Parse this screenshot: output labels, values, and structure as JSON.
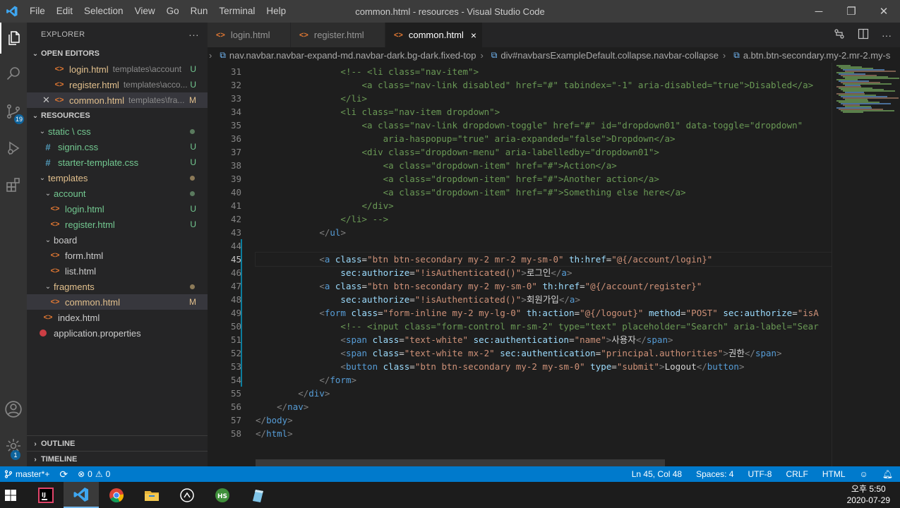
{
  "app": {
    "window_title": "common.html - resources - Visual Studio Code",
    "menu": [
      "File",
      "Edit",
      "Selection",
      "View",
      "Go",
      "Run",
      "Terminal",
      "Help"
    ]
  },
  "activity": {
    "scm_badge": "19",
    "settings_badge": "1"
  },
  "sidebar": {
    "title": "EXPLORER",
    "more": "···",
    "open_editors": {
      "label": "OPEN EDITORS",
      "items": [
        {
          "name": "login.html",
          "path": "templates\\account",
          "status": "U"
        },
        {
          "name": "register.html",
          "path": "templates\\acco...",
          "status": "U"
        },
        {
          "name": "common.html",
          "path": "templates\\fra...",
          "status": "M"
        }
      ]
    },
    "resources": {
      "label": "RESOURCES",
      "static_css": "static \\ css",
      "signin": "signin.css",
      "starter": "starter-template.css",
      "templates": "templates",
      "account": "account",
      "login": "login.html",
      "register": "register.html",
      "board": "board",
      "form": "form.html",
      "list": "list.html",
      "fragments": "fragments",
      "common": "common.html",
      "index": "index.html",
      "appprops": "application.properties",
      "status_u": "U",
      "status_m": "M"
    },
    "outline": "OUTLINE",
    "timeline": "TIMELINE"
  },
  "tabs": [
    {
      "label": "login.html"
    },
    {
      "label": "register.html"
    },
    {
      "label": "common.html",
      "close": "×"
    }
  ],
  "breadcrumb": {
    "lead": "›",
    "crumb1": "nav.navbar.navbar-expand-md.navbar-dark.bg-dark.fixed-top",
    "crumb2": "div#navbarsExampleDefault.collapse.navbar-collapse",
    "crumb3": "a.btn.btn-secondary.my-2.mr-2.my-s"
  },
  "editor": {
    "line_numbers": [
      "31",
      "32",
      "33",
      "34",
      "35",
      "36",
      "37",
      "38",
      "39",
      "40",
      "41",
      "42",
      "43",
      "44",
      "45",
      "46",
      "47",
      "48",
      "49",
      "50",
      "51",
      "52",
      "53",
      "54",
      "55",
      "56",
      "57",
      "58"
    ]
  },
  "status": {
    "branch": "master*+",
    "sync": "⟳",
    "errors": "0",
    "warnings": "0",
    "position": "Ln 45, Col 48",
    "spaces": "Spaces: 4",
    "encoding": "UTF-8",
    "eol": "CRLF",
    "language": "HTML"
  },
  "taskbar": {
    "time": "오후 5:50",
    "date": "2020-07-29"
  },
  "colors": {
    "statusbar": "#007acc",
    "accent": "#0e639c"
  }
}
